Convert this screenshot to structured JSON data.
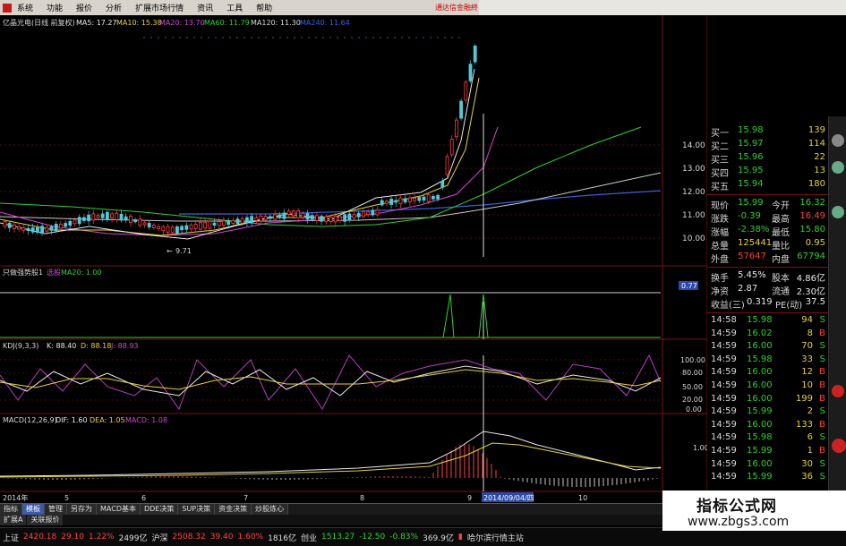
{
  "menu": {
    "items": [
      "系统",
      "功能",
      "报价",
      "分析",
      "扩展市场行情",
      "资讯",
      "工具",
      "帮助"
    ],
    "ad_text": "通达信金融終"
  },
  "main_chart": {
    "title": "亿晶光电(日线 前复权)",
    "ma": [
      {
        "label": "MA5: 17.27",
        "color": "#e8e8e8"
      },
      {
        "label": "MA10: 15.38",
        "color": "#e6d23a"
      },
      {
        "label": "MA20: 13.70",
        "color": "#d04ad0"
      },
      {
        "label": "MA60: 11.79",
        "color": "#2ed12e"
      },
      {
        "label": "MA120: 11.30",
        "color": "#d8d8d8"
      },
      {
        "label": "MA240: 11.64",
        "color": "#3a5fd8"
      }
    ],
    "y_ticks": [
      "14.00",
      "13.00",
      "12.00",
      "11.00",
      "10.00"
    ],
    "low_annotation": "9.71"
  },
  "indicator1": {
    "title": "只做强势股1",
    "sub1": "选股",
    "sub2": "MA20: 1.00",
    "value_badge": "0.77"
  },
  "kdj": {
    "title": "KDJ(9,3,3)",
    "k": "K: 88.40",
    "d": "D: 88.18",
    "j": "J: 88.93",
    "y_ticks": [
      "100.00",
      "80.00",
      "50.00",
      "20.00",
      "0.00"
    ]
  },
  "macd": {
    "title": "MACD(12,26,9)",
    "dif": "DIF: 1.60",
    "dea": "DEA: 1.05",
    "macd": "MACD: 1.08",
    "y_ticks": [
      "1.00"
    ]
  },
  "x_axis": {
    "labels": [
      "2014年",
      "5",
      "6",
      "7",
      "8",
      "9",
      "10"
    ],
    "cursor_date": "2014/09/04/四"
  },
  "panel": {
    "bids": [
      {
        "label": "买一",
        "price": "15.98",
        "vol": "139"
      },
      {
        "label": "买二",
        "price": "15.97",
        "vol": "114"
      },
      {
        "label": "买三",
        "price": "15.96",
        "vol": "22"
      },
      {
        "label": "买四",
        "price": "15.95",
        "vol": "13"
      },
      {
        "label": "买五",
        "price": "15.94",
        "vol": "180"
      }
    ],
    "quote": [
      {
        "label": "现价",
        "value": "15.99",
        "label2": "今开",
        "value2": "16.32"
      },
      {
        "label": "涨跌",
        "value": "-0.39",
        "label2": "最高",
        "value2": "16.49"
      },
      {
        "label": "涨幅",
        "value": "-2.38%",
        "label2": "最低",
        "value2": "15.80"
      },
      {
        "label": "总量",
        "value": "125441",
        "label2": "量比",
        "value2": "0.95"
      },
      {
        "label": "外盘",
        "value": "57647",
        "label2": "内盘",
        "value2": "67794"
      }
    ],
    "fundamentals": [
      {
        "label": "换手",
        "value": "5.45%",
        "label2": "股本",
        "value2": "4.86亿"
      },
      {
        "label": "净资",
        "value": "2.87",
        "label2": "流通",
        "value2": "2.30亿"
      },
      {
        "label": "收益(三)",
        "value": "0.319",
        "label2": "PE(动)",
        "value2": "37.5"
      }
    ],
    "ticks": [
      {
        "time": "14:58",
        "price": "15.98",
        "vol": "94",
        "side": "S"
      },
      {
        "time": "14:59",
        "price": "16.02",
        "vol": "8",
        "side": "B"
      },
      {
        "time": "14:59",
        "price": "16.00",
        "vol": "70",
        "side": "S"
      },
      {
        "time": "14:59",
        "price": "15.98",
        "vol": "33",
        "side": "S"
      },
      {
        "time": "14:59",
        "price": "16.00",
        "vol": "12",
        "side": "B"
      },
      {
        "time": "14:59",
        "price": "16.00",
        "vol": "10",
        "side": "B"
      },
      {
        "time": "14:59",
        "price": "16.00",
        "vol": "199",
        "side": "B"
      },
      {
        "time": "14:59",
        "price": "15.99",
        "vol": "2",
        "side": "S"
      },
      {
        "time": "14:59",
        "price": "16.00",
        "vol": "133",
        "side": "B"
      },
      {
        "time": "14:59",
        "price": "15.98",
        "vol": "6",
        "side": "S"
      },
      {
        "time": "14:59",
        "price": "15.99",
        "vol": "1",
        "side": "B"
      },
      {
        "time": "14:59",
        "price": "16.00",
        "vol": "30",
        "side": "S"
      },
      {
        "time": "14:59",
        "price": "15.99",
        "vol": "36",
        "side": "S"
      }
    ]
  },
  "tabs1": [
    "指标",
    "模板",
    "管理",
    "另存为",
    "MACD基本",
    "DDE决策",
    "SUP决策",
    "资金决策",
    "炒股炼心"
  ],
  "tabs2": [
    "扩展A",
    "关联报价"
  ],
  "status": {
    "sh_label": "上证",
    "sh_value": "2420.18",
    "sh_change": "29.10",
    "sh_pct": "1.22%",
    "sh_amount": "2499亿",
    "hs300_label": "沪深",
    "hs300_value": "2508.32",
    "hs300_change": "39.40",
    "hs300_pct": "1.60%",
    "hs300_amount": "1816亿",
    "cy_label": "创业",
    "cy_value": "1513.27",
    "cy_change": "-12.50",
    "cy_pct": "-0.83%",
    "cy_amount": "369.9亿",
    "site": "哈尔滨行情主站"
  },
  "watermark": {
    "title": "指标公式网",
    "url": "www.zbgs3.com"
  },
  "colors": {
    "up": "#ff4040",
    "down": "#2ed12e",
    "bg": "#000000",
    "grid": "#6a1010"
  }
}
